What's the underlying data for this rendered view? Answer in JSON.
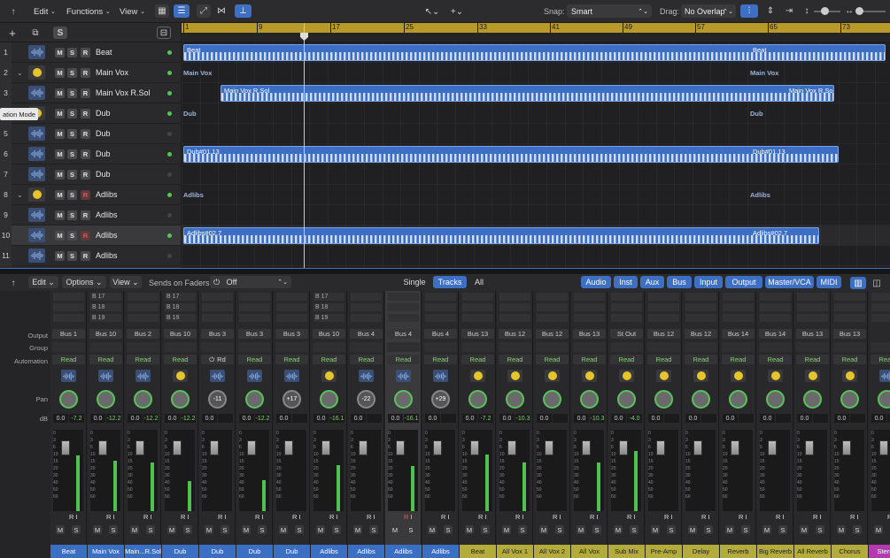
{
  "tracks_toolbar": {
    "edit": "Edit",
    "functions": "Functions",
    "view": "View",
    "snap_label": "Snap:",
    "snap_value": "Smart",
    "drag_label": "Drag:",
    "drag_value": "No Overlap"
  },
  "ruler": [
    "1",
    "9",
    "17",
    "25",
    "33",
    "41",
    "49",
    "57",
    "65",
    "73"
  ],
  "tracks": [
    {
      "num": "1",
      "name": "Beat",
      "chev": "",
      "type": "audio",
      "led": "#4ec84e"
    },
    {
      "num": "2",
      "name": "Main Vox",
      "chev": "v",
      "type": "stack",
      "led": "#4ec84e"
    },
    {
      "num": "3",
      "name": "Main Vox R.Sol",
      "chev": "",
      "type": "audio",
      "led": "#4ec84e"
    },
    {
      "num": "4",
      "name": "Dub",
      "chev": "",
      "type": "stack",
      "led": "#4ec84e"
    },
    {
      "num": "5",
      "name": "Dub",
      "chev": "",
      "type": "audio",
      "led": "#444"
    },
    {
      "num": "6",
      "name": "Dub",
      "chev": "",
      "type": "audio",
      "led": "#4ec84e"
    },
    {
      "num": "7",
      "name": "Dub",
      "chev": "",
      "type": "audio",
      "led": "#444"
    },
    {
      "num": "8",
      "name": "Adlibs",
      "chev": "v",
      "type": "stack",
      "led": "#4ec84e"
    },
    {
      "num": "9",
      "name": "Adlibs",
      "chev": "",
      "type": "audio",
      "led": "#444"
    },
    {
      "num": "10",
      "name": "Adlibs",
      "chev": "",
      "type": "audio",
      "led": "#4ec84e"
    },
    {
      "num": "11",
      "name": "Adlibs",
      "chev": "",
      "type": "audio",
      "led": "#444"
    }
  ],
  "tooltip": "ation Mode",
  "regions": {
    "beat_a": "Beat",
    "beat_b": "Beat",
    "mainvox_ghost_a": "Main Vox",
    "mainvox_ghost_b": "Main Vox",
    "mainvox_sol_a": "Main Vox R.Sol",
    "mainvox_sol_b": "Main Vox R.Sol",
    "dub_ghost_a": "Dub",
    "dub_ghost_b": "Dub",
    "dub_a": "Dub#01.13",
    "dub_b": "Dub#01.13",
    "adlibs_ghost_a": "Adlibs",
    "adlibs_ghost_b": "Adlibs",
    "adlibs_a": "Adlibs#02.7",
    "adlibs_b": "Adlibs#02.7"
  },
  "mixer_toolbar": {
    "edit": "Edit",
    "options": "Options",
    "view": "View",
    "sends_label": "Sends on Faders:",
    "sends_value": "Off",
    "tabs": [
      "Single",
      "Tracks",
      "All"
    ],
    "filters": [
      "Audio",
      "Inst",
      "Aux",
      "Bus",
      "Input",
      "Output",
      "Master/VCA",
      "MIDI"
    ]
  },
  "row_labels": {
    "output": "Output",
    "group": "Group",
    "automation": "Automation",
    "pan": "Pan",
    "db": "dB"
  },
  "fader_scale": [
    "0",
    "3",
    "6",
    "10",
    "15",
    "20",
    "30",
    "40",
    "50",
    "60"
  ],
  "strips": [
    {
      "name": "Beat",
      "out": "Bus 1",
      "auto": "Read",
      "pan": "",
      "db": "0.0",
      "peak": "-7.2",
      "meter": 0.68,
      "color": "#3a6fc4",
      "slots": [],
      "plug": "wave",
      "sel": false,
      "mute_r": false
    },
    {
      "name": "Main Vox",
      "out": "Bus 10",
      "auto": "Read",
      "pan": "",
      "db": "0.0",
      "peak": "-12.2",
      "meter": 0.62,
      "color": "#3a6fc4",
      "slots": [
        "B 17",
        "B 18",
        "B 19"
      ],
      "plug": "wave",
      "sel": false,
      "mute_r": false
    },
    {
      "name": "Main...R.Sol",
      "out": "Bus 2",
      "auto": "Read",
      "pan": "",
      "db": "0.0",
      "peak": "-12.2",
      "meter": 0.6,
      "color": "#3a6fc4",
      "slots": [],
      "plug": "wave",
      "sel": false,
      "mute_r": false
    },
    {
      "name": "Dub",
      "out": "Bus 10",
      "auto": "Read",
      "pan": "",
      "db": "0.0",
      "peak": "-12.2",
      "meter": 0.37,
      "color": "#3a6fc4",
      "slots": [
        "B 17",
        "B 18",
        "B 19"
      ],
      "plug": "yellow",
      "sel": false,
      "mute_r": false
    },
    {
      "name": "Dub",
      "out": "Bus 3",
      "auto": "Rd",
      "pan": "-11",
      "db": "0.0",
      "peak": "",
      "meter": 0.0,
      "color": "#3a6fc4",
      "slots": [],
      "plug": "wave",
      "sel": false,
      "mute_r": false
    },
    {
      "name": "Dub",
      "out": "Bus 3",
      "auto": "Read",
      "pan": "",
      "db": "0.0",
      "peak": "-12.2",
      "meter": 0.38,
      "color": "#3a6fc4",
      "slots": [],
      "plug": "wave",
      "sel": false,
      "mute_r": false
    },
    {
      "name": "Dub",
      "out": "Bus 3",
      "auto": "Read",
      "pan": "+17",
      "db": "0.0",
      "peak": "",
      "meter": 0.0,
      "color": "#3a6fc4",
      "slots": [],
      "plug": "wave",
      "sel": false,
      "mute_r": false
    },
    {
      "name": "Adlibs",
      "out": "Bus 10",
      "auto": "Read",
      "pan": "",
      "db": "0.0",
      "peak": "-16.1",
      "meter": 0.56,
      "color": "#3a6fc4",
      "slots": [
        "B 17",
        "B 18",
        "B 19"
      ],
      "plug": "yellow",
      "sel": false,
      "mute_r": false
    },
    {
      "name": "Adlibs",
      "out": "Bus 4",
      "auto": "Read",
      "pan": "-22",
      "db": "0.0",
      "peak": "",
      "meter": 0.0,
      "color": "#3a6fc4",
      "slots": [],
      "plug": "wave",
      "sel": false,
      "mute_r": false
    },
    {
      "name": "Adlibs",
      "out": "Bus 4",
      "auto": "Read",
      "pan": "",
      "db": "0.0",
      "peak": "-16.1",
      "meter": 0.55,
      "color": "#3a6fc4",
      "slots": [],
      "plug": "wave",
      "sel": true,
      "mute_r": true
    },
    {
      "name": "Adlibs",
      "out": "Bus 4",
      "auto": "Read",
      "pan": "+29",
      "db": "0.0",
      "peak": "",
      "meter": 0.0,
      "color": "#3a6fc4",
      "slots": [],
      "plug": "wave",
      "sel": false,
      "mute_r": false
    },
    {
      "name": "Beat",
      "out": "Bus 13",
      "auto": "Read",
      "pan": "",
      "db": "0.0",
      "peak": "-7.2",
      "meter": 0.7,
      "color": "#b3ab3a",
      "slots": [],
      "plug": "yellow",
      "sel": false,
      "mute_r": false
    },
    {
      "name": "All Vox 1",
      "out": "Bus 12",
      "auto": "Read",
      "pan": "",
      "db": "0.0",
      "peak": "-10.3",
      "meter": 0.6,
      "color": "#b3ab3a",
      "slots": [],
      "plug": "yellow",
      "sel": false,
      "mute_r": false
    },
    {
      "name": "All Vox 2",
      "out": "Bus 12",
      "auto": "Read",
      "pan": "",
      "db": "0.0",
      "peak": "",
      "meter": 0.0,
      "color": "#b3ab3a",
      "slots": [],
      "plug": "yellow",
      "sel": false,
      "mute_r": false
    },
    {
      "name": "All Vox",
      "out": "Bus 13",
      "auto": "Read",
      "pan": "",
      "db": "0.0",
      "peak": "-10.3",
      "meter": 0.6,
      "color": "#b3ab3a",
      "slots": [],
      "plug": "yellow",
      "sel": false,
      "mute_r": false
    },
    {
      "name": "Sub Mix",
      "out": "St Out",
      "auto": "Read",
      "pan": "",
      "db": "0.0",
      "peak": "-4.0",
      "meter": 0.74,
      "color": "#b3ab3a",
      "slots": [],
      "plug": "yellow",
      "sel": false,
      "mute_r": false
    },
    {
      "name": "Pre-Amp",
      "out": "Bus 12",
      "auto": "Read",
      "pan": "",
      "db": "0.0",
      "peak": "",
      "meter": 0.0,
      "color": "#b3ab3a",
      "slots": [],
      "plug": "yellow",
      "sel": false,
      "mute_r": false
    },
    {
      "name": "Delay",
      "out": "Bus 12",
      "auto": "Read",
      "pan": "",
      "db": "0.0",
      "peak": "",
      "meter": 0.0,
      "color": "#b3ab3a",
      "slots": [],
      "plug": "yellow",
      "sel": false,
      "mute_r": false
    },
    {
      "name": "Reverb",
      "out": "Bus 14",
      "auto": "Read",
      "pan": "",
      "db": "0.0",
      "peak": "",
      "meter": 0.0,
      "color": "#b3ab3a",
      "slots": [],
      "plug": "yellow",
      "sel": false,
      "mute_r": false
    },
    {
      "name": "Big Reverb",
      "out": "Bus 14",
      "auto": "Read",
      "pan": "",
      "db": "0.0",
      "peak": "",
      "meter": 0.0,
      "color": "#b3ab3a",
      "slots": [],
      "plug": "yellow",
      "sel": false,
      "mute_r": false
    },
    {
      "name": "All Reverb",
      "out": "Bus 13",
      "auto": "Read",
      "pan": "",
      "db": "0.0",
      "peak": "",
      "meter": 0.0,
      "color": "#b3ab3a",
      "slots": [],
      "plug": "yellow",
      "sel": false,
      "mute_r": false
    },
    {
      "name": "Chorus",
      "out": "Bus 13",
      "auto": "Read",
      "pan": "",
      "db": "0.0",
      "peak": "",
      "meter": 0.0,
      "color": "#b3ab3a",
      "slots": [],
      "plug": "yellow",
      "sel": false,
      "mute_r": false
    },
    {
      "name": "Stereo",
      "out": "",
      "auto": "Read",
      "pan": "",
      "db": "0.0",
      "peak": "",
      "meter": 0.0,
      "color": "#b33ab0",
      "slots": [],
      "plug": "wave",
      "sel": false,
      "mute_r": false
    }
  ]
}
